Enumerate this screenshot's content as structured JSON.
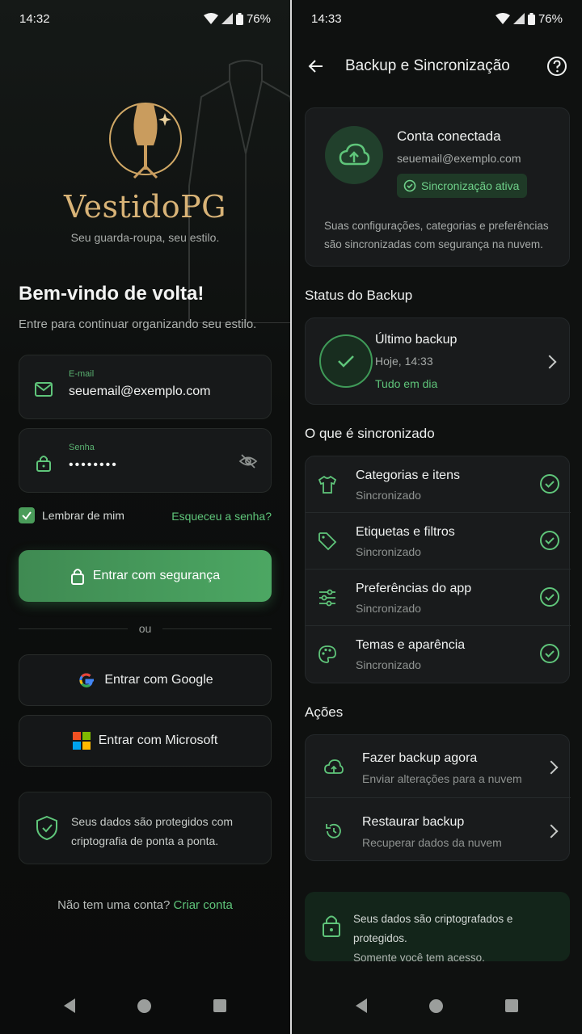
{
  "left": {
    "status_bar": {
      "time": "14:32",
      "battery": "76%"
    },
    "brand": {
      "name": "VestidoPG",
      "tagline": "Seu guarda-roupa, seu estilo."
    },
    "welcome": {
      "title": "Bem-vindo de volta!",
      "subtitle": "Entre para continuar organizando seu estilo."
    },
    "email_field": {
      "label": "E-mail",
      "value": "seuemail@exemplo.com"
    },
    "password_field": {
      "label": "Senha",
      "value": "••••••••"
    },
    "remember_label": "Lembrar de mim",
    "remember_checked": true,
    "forgot_label": "Esqueceu a senha?",
    "login_button": "Entrar com segurança",
    "or_label": "ou",
    "google_button": "Entrar com Google",
    "microsoft_button": "Entrar com Microsoft",
    "security_notice": "Seus dados são protegidos com criptografia de ponta a ponta.",
    "signup_prompt": "Não tem uma conta?",
    "signup_link": "Criar conta"
  },
  "right": {
    "status_bar": {
      "time": "14:33",
      "battery": "76%"
    },
    "header": {
      "title": "Backup e Sincronização"
    },
    "account": {
      "title": "Conta conectada",
      "email": "seuemail@exemplo.com",
      "badge": "Sincronização ativa",
      "description": "Suas configurações, categorias e preferências são sincronizadas com segurança na nuvem."
    },
    "backup_status": {
      "section_title": "Status do Backup",
      "title": "Último backup",
      "time": "Hoje, 14:33",
      "status": "Tudo em dia"
    },
    "synced": {
      "section_title": "O que é sincronizado",
      "items": [
        {
          "title": "Categorias e itens",
          "status": "Sincronizado",
          "icon": "shirt-icon"
        },
        {
          "title": "Etiquetas e filtros",
          "status": "Sincronizado",
          "icon": "tag-icon"
        },
        {
          "title": "Preferências do app",
          "status": "Sincronizado",
          "icon": "sliders-icon"
        },
        {
          "title": "Temas e aparência",
          "status": "Sincronizado",
          "icon": "palette-icon"
        }
      ]
    },
    "actions": {
      "section_title": "Ações",
      "items": [
        {
          "title": "Fazer backup agora",
          "subtitle": "Enviar alterações para a nuvem",
          "icon": "cloud-upload-icon"
        },
        {
          "title": "Restaurar backup",
          "subtitle": "Recuperar dados da nuvem",
          "icon": "restore-icon"
        }
      ]
    },
    "security_notice": {
      "line1": "Seus dados são criptografados e protegidos.",
      "line2": "Somente você tem acesso."
    }
  },
  "colors": {
    "accent_green": "#5fc57a",
    "brand_gold": "#d8b377",
    "background": "#0f1110"
  }
}
